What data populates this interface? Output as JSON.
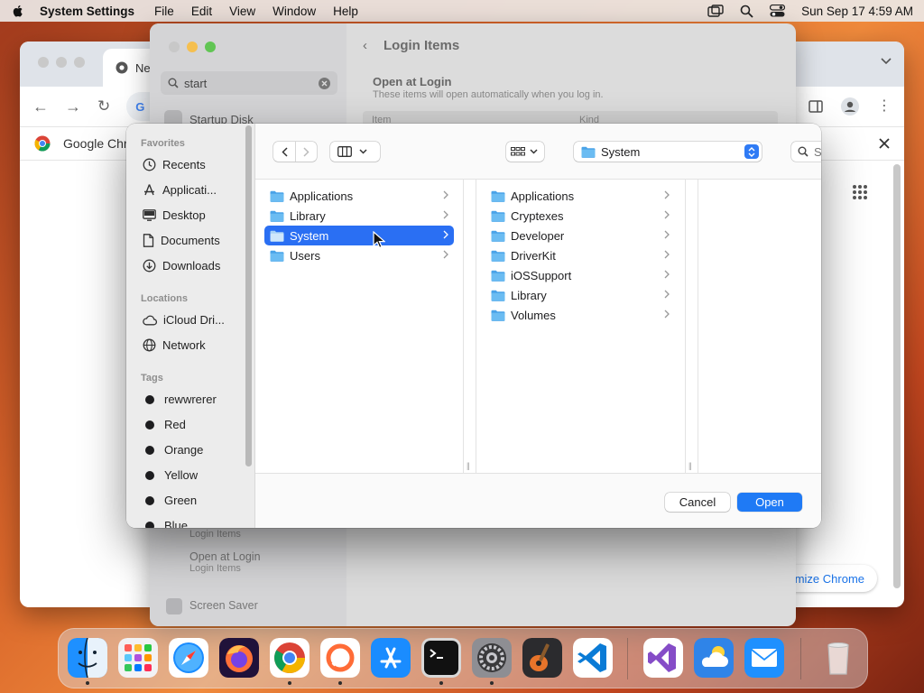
{
  "menubar": {
    "app_name": "System Settings",
    "menus": [
      "File",
      "Edit",
      "View",
      "Window",
      "Help"
    ],
    "datetime": "Sun Sep 17  4:59 AM"
  },
  "chrome": {
    "tab_title": "Ne",
    "sidepanel_title": "Google Chr",
    "customize_label": "mize Chrome"
  },
  "settings": {
    "search_value": "start",
    "sidebar_item": "Startup Disk",
    "header_title": "Login Items",
    "section_title": "Open at Login",
    "section_subtitle": "These items will open automatically when you log in.",
    "table_headers": [
      "Item",
      "Kind"
    ],
    "lower_items": [
      {
        "title": "",
        "subtitle": "Login Items"
      },
      {
        "title": "Open at Login",
        "subtitle": "Login Items"
      },
      {
        "title": "Screen Saver",
        "subtitle": ""
      }
    ]
  },
  "dialog": {
    "sidebar": {
      "favorites_header": "Favorites",
      "favorites": [
        {
          "label": "Recents",
          "icon": "clock-icon"
        },
        {
          "label": "Applicati...",
          "icon": "applications-icon"
        },
        {
          "label": "Desktop",
          "icon": "desktop-icon"
        },
        {
          "label": "Documents",
          "icon": "document-icon"
        },
        {
          "label": "Downloads",
          "icon": "download-icon"
        }
      ],
      "locations_header": "Locations",
      "locations": [
        {
          "label": "iCloud Dri...",
          "icon": "cloud-icon"
        },
        {
          "label": "Network",
          "icon": "globe-icon"
        }
      ],
      "tags_header": "Tags",
      "tags": [
        {
          "label": "rewwrerer",
          "color": "#1d1d1f"
        },
        {
          "label": "Red",
          "color": "#1d1d1f"
        },
        {
          "label": "Orange",
          "color": "#1d1d1f"
        },
        {
          "label": "Yellow",
          "color": "#1d1d1f"
        },
        {
          "label": "Green",
          "color": "#1d1d1f"
        },
        {
          "label": "Blue",
          "color": "#1d1d1f"
        }
      ]
    },
    "toolbar": {
      "path_label": "System",
      "search_placeholder": "Search"
    },
    "column1": {
      "items": [
        "Applications",
        "Library",
        "System",
        "Users"
      ],
      "selected": "System"
    },
    "column2": {
      "items": [
        "Applications",
        "Cryptexes",
        "Developer",
        "DriverKit",
        "iOSSupport",
        "Library",
        "Volumes"
      ]
    },
    "buttons": {
      "cancel": "Cancel",
      "open": "Open"
    },
    "accent_color": "#2a6ff3"
  },
  "dock": {
    "apps": [
      "Finder",
      "Launchpad",
      "Safari",
      "Firefox",
      "Chrome",
      "Postman",
      "App Store",
      "Terminal",
      "System Settings",
      "GarageBand",
      "VS Code",
      "Visual Studio",
      "Weather",
      "Mail",
      "Trash"
    ]
  }
}
